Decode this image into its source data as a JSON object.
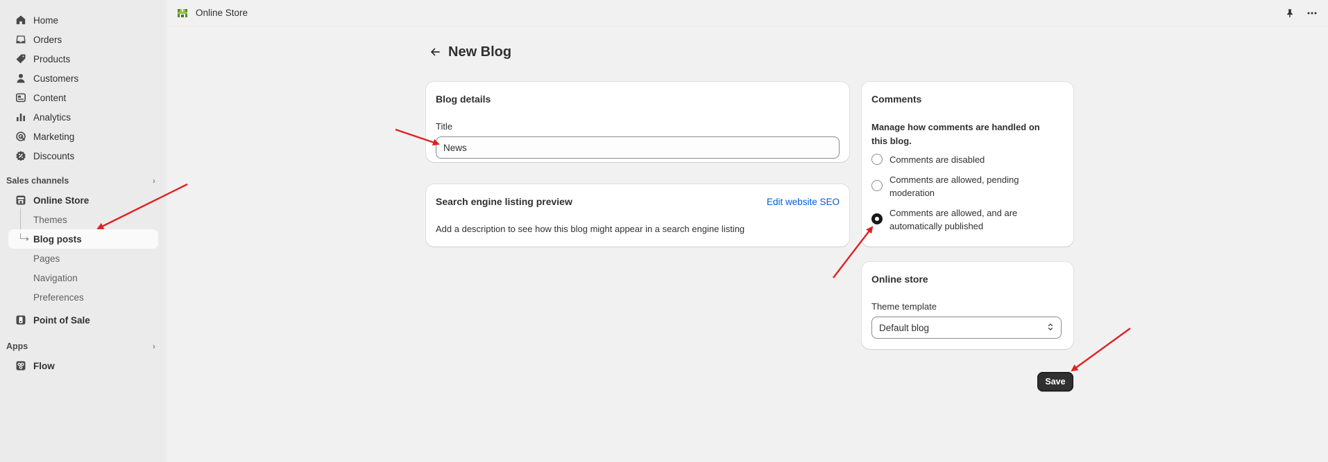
{
  "sidebar": {
    "main_items": [
      {
        "label": "Home",
        "icon": "home-icon"
      },
      {
        "label": "Orders",
        "icon": "inbox-icon"
      },
      {
        "label": "Products",
        "icon": "tag-icon"
      },
      {
        "label": "Customers",
        "icon": "person-icon"
      },
      {
        "label": "Content",
        "icon": "content-icon"
      },
      {
        "label": "Analytics",
        "icon": "chart-icon"
      },
      {
        "label": "Marketing",
        "icon": "target-icon"
      },
      {
        "label": "Discounts",
        "icon": "discount-icon"
      }
    ],
    "sales_channels_label": "Sales channels",
    "online_store_label": "Online Store",
    "online_store_sub": [
      "Themes",
      "Blog posts",
      "Pages",
      "Navigation",
      "Preferences"
    ],
    "active_sub": "Blog posts",
    "pos_label": "Point of Sale",
    "apps_label": "Apps",
    "flow_label": "Flow"
  },
  "topbar": {
    "app_title": "Online Store",
    "pin_icon": "pin-icon",
    "more_icon": "more-horizontal-icon"
  },
  "page": {
    "title": "New Blog"
  },
  "blog_details": {
    "heading": "Blog details",
    "title_label": "Title",
    "title_value": "News"
  },
  "seo": {
    "heading": "Search engine listing preview",
    "edit_link": "Edit website SEO",
    "description": "Add a description to see how this blog might appear in a search engine listing"
  },
  "comments": {
    "heading": "Comments",
    "description": "Manage how comments are handled on this blog.",
    "options": [
      {
        "line1": "Comments are disabled",
        "line2": "",
        "checked": false
      },
      {
        "line1": "Comments are allowed, pending",
        "line2": "moderation",
        "checked": false
      },
      {
        "line1": "Comments are allowed, and are",
        "line2": "automatically published",
        "checked": true
      }
    ]
  },
  "online_store_card": {
    "heading": "Online store",
    "template_label": "Theme template",
    "template_value": "Default blog"
  },
  "save_label": "Save",
  "colors": {
    "annotation_arrow": "#e02020",
    "link": "#005bd3",
    "primary_button": "#303030"
  }
}
